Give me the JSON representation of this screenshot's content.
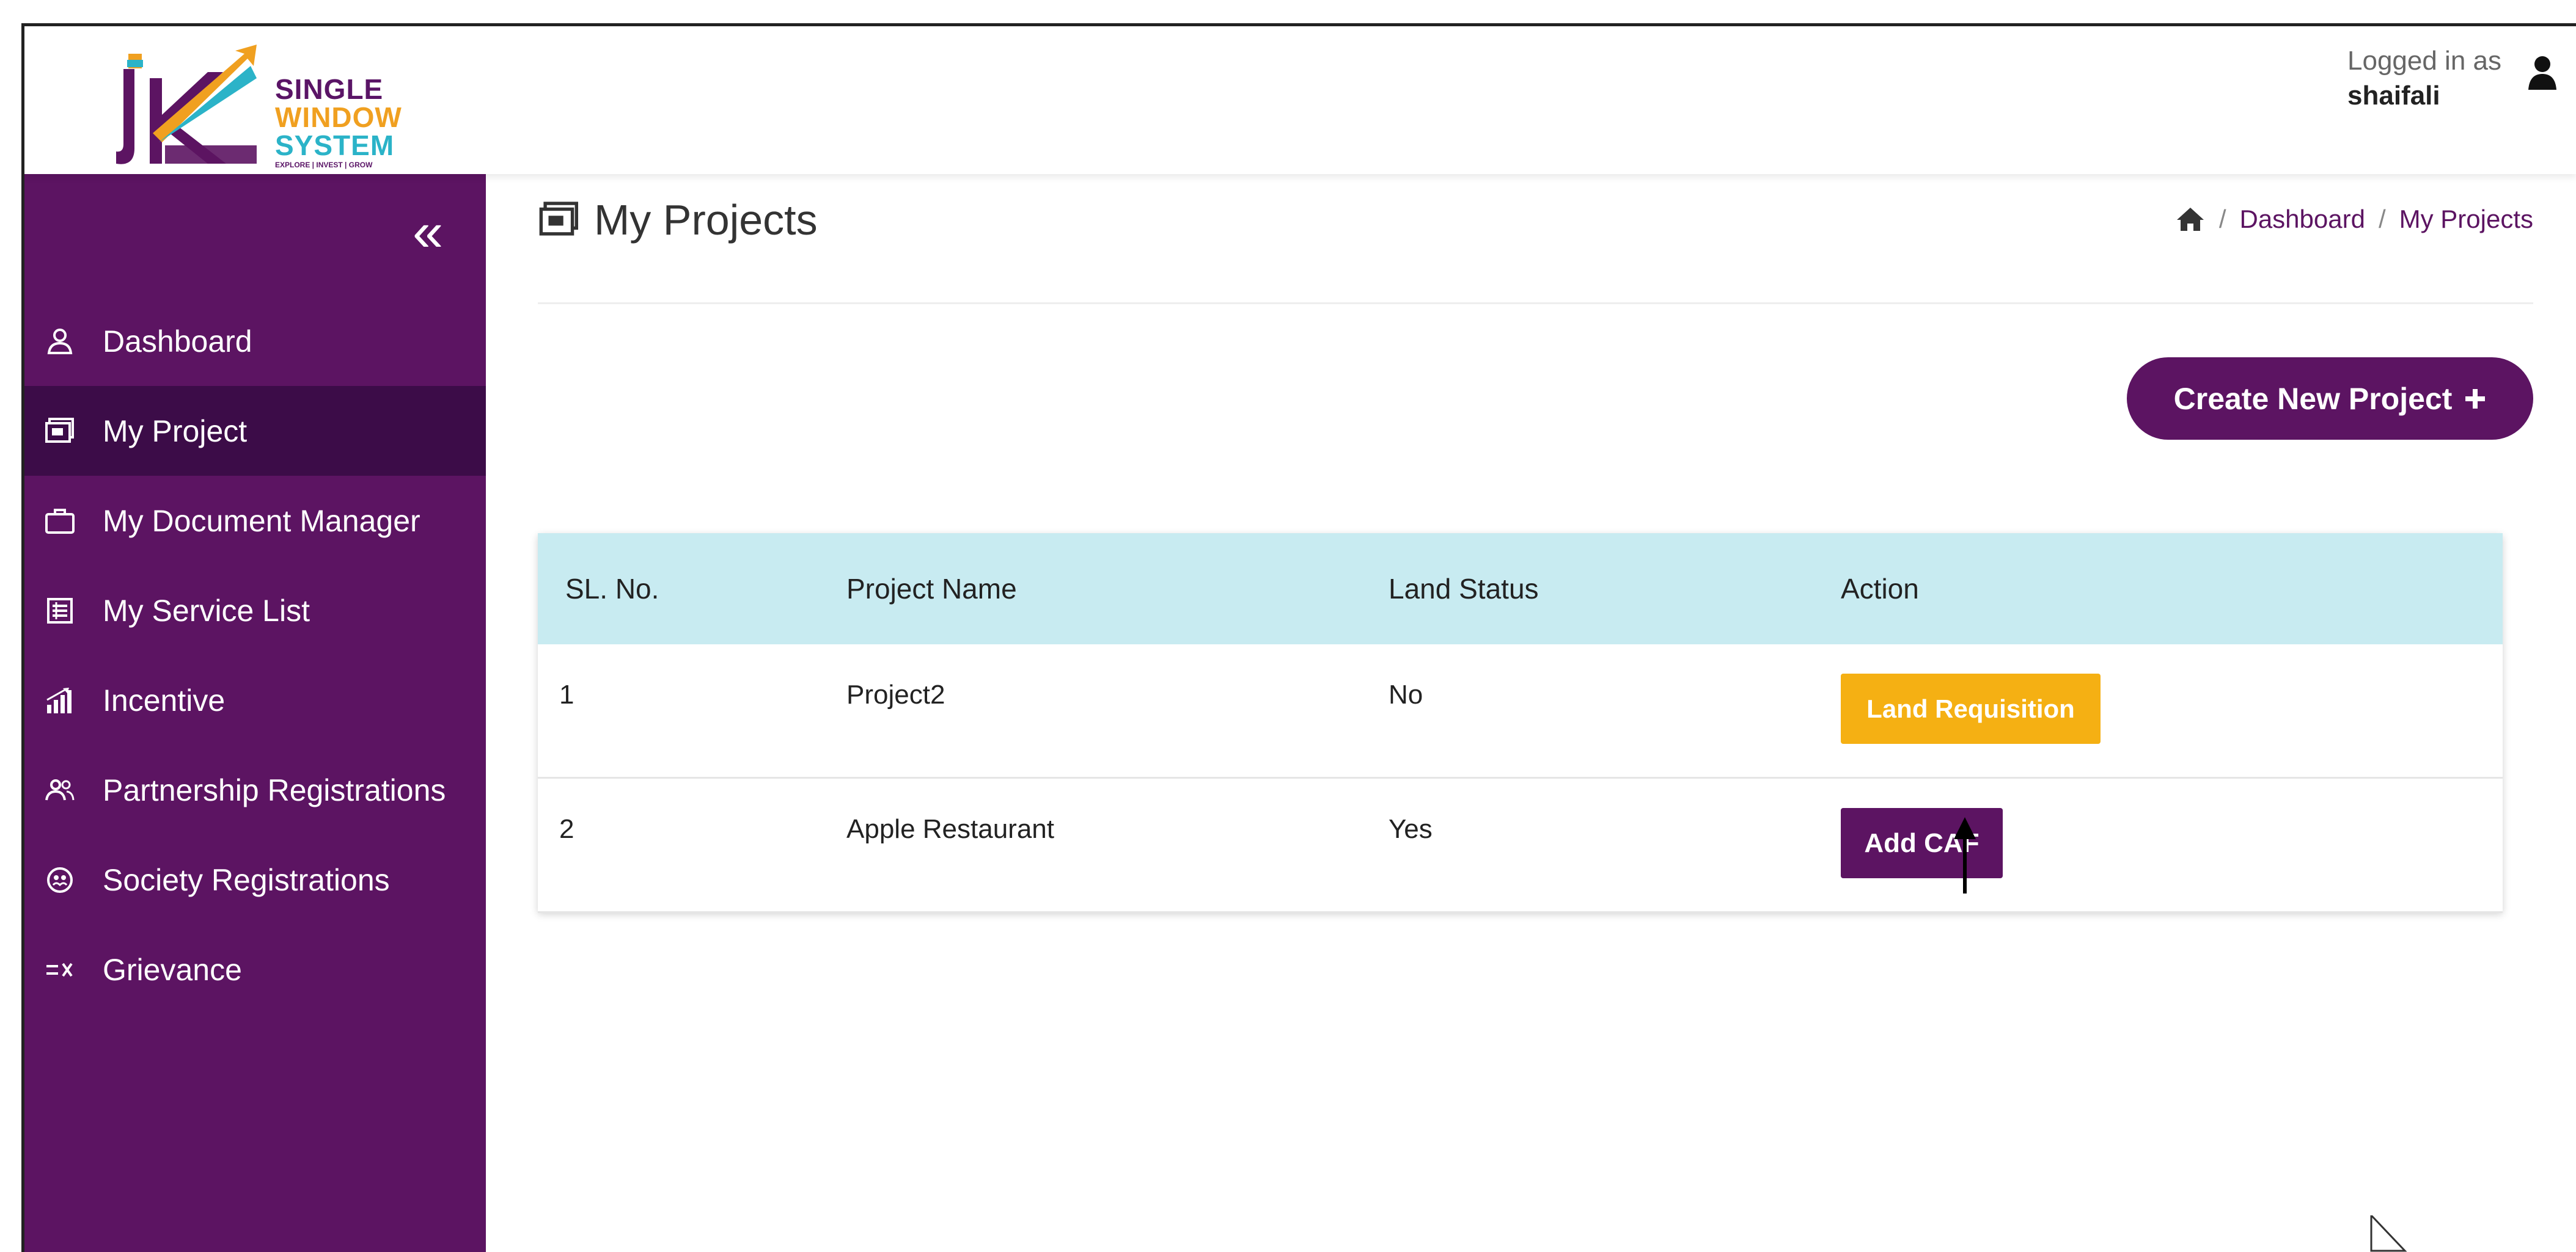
{
  "brand": {
    "line1": "SINGLE",
    "line2": "WINDOW",
    "line3": "SYSTEM",
    "tagline": "EXPLORE | INVEST | GROW",
    "colors": {
      "purple": "#5c1462",
      "orange": "#f0a020",
      "teal": "#2bb3c8"
    }
  },
  "user": {
    "label": "Logged in as",
    "name": "shaifali",
    "icon": "user-icon"
  },
  "sidebar": {
    "collapse_icon": "double-chevron-left-icon",
    "items": [
      {
        "label": "Dashboard",
        "icon": "user-icon"
      },
      {
        "label": "My Project",
        "icon": "projects-icon",
        "active": true
      },
      {
        "label": "My Document Manager",
        "icon": "briefcase-icon"
      },
      {
        "label": "My Service List",
        "icon": "list-icon"
      },
      {
        "label": "Incentive",
        "icon": "chart-icon"
      },
      {
        "label": "Partnership Registrations",
        "icon": "group-icon"
      },
      {
        "label": "Society Registrations",
        "icon": "society-icon"
      },
      {
        "label": "Grievance",
        "icon": "grievance-icon"
      }
    ]
  },
  "page": {
    "title": "My Projects",
    "title_icon": "projects-icon"
  },
  "breadcrumb": {
    "home_icon": "home-icon",
    "items": [
      "Dashboard",
      "My Projects"
    ],
    "separator": "/"
  },
  "actions": {
    "create_label": "Create New Project"
  },
  "table": {
    "headers": [
      "SL. No.",
      "Project Name",
      "Land Status",
      "Action"
    ],
    "rows": [
      {
        "sl": "1",
        "name": "Project2",
        "land": "No",
        "action": "Land Requisition",
        "action_color": "#f5b013"
      },
      {
        "sl": "2",
        "name": "Apple Restaurant",
        "land": "Yes",
        "action": "Add CAF",
        "action_color": "#5c1462"
      }
    ]
  }
}
